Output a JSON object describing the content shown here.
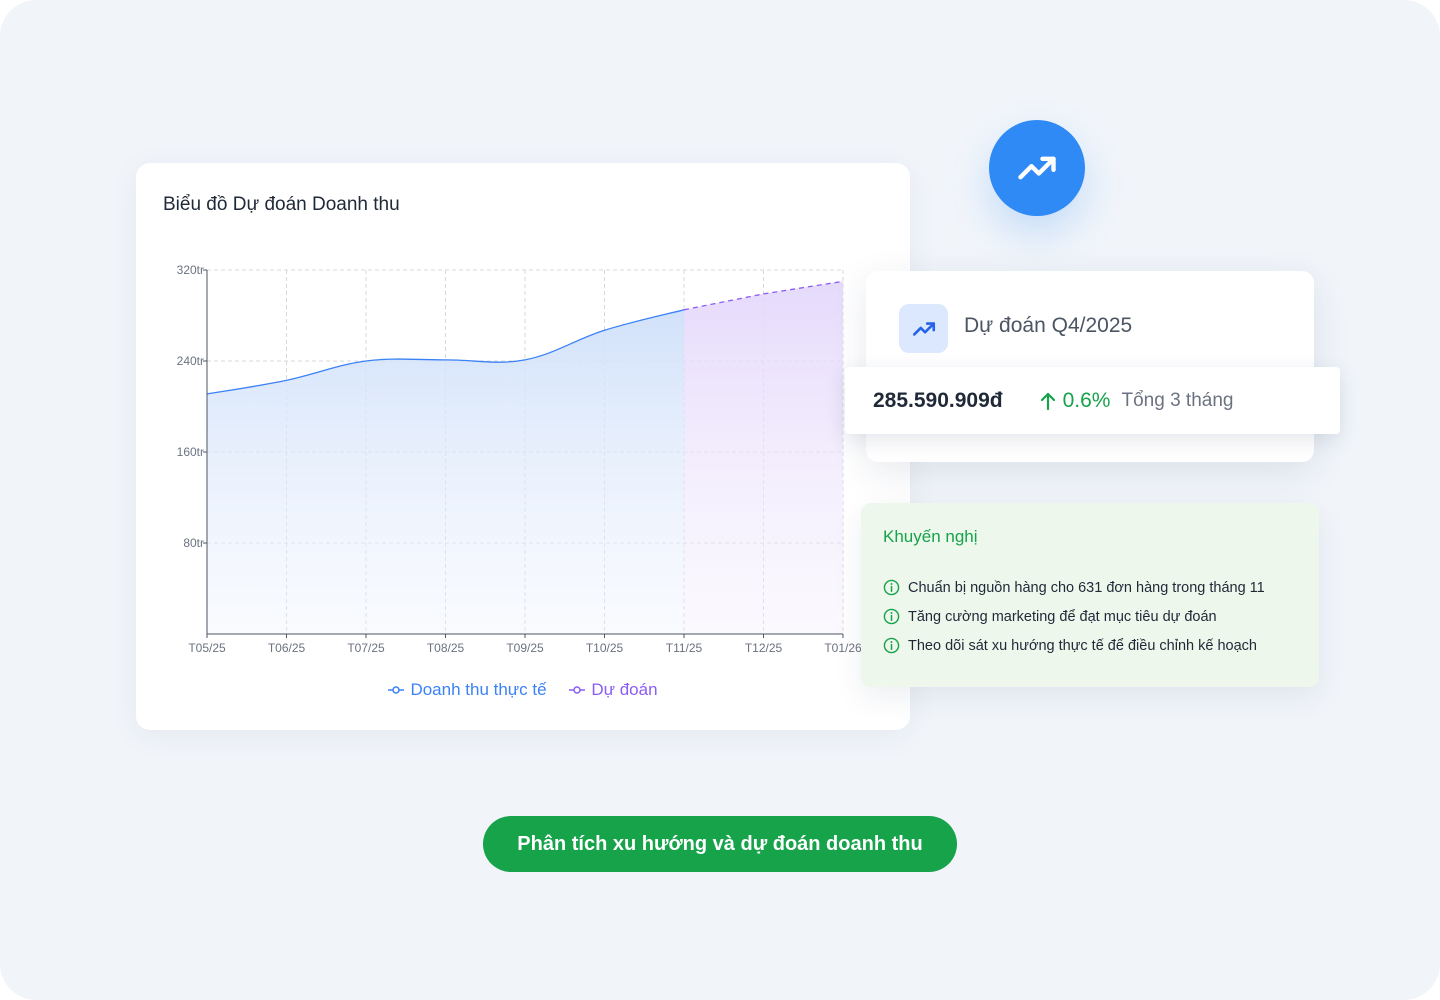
{
  "chart_card": {
    "title": "Biểu đồ Dự đoán Doanh thu"
  },
  "chart_data": {
    "type": "area",
    "categories": [
      "T05/25",
      "T06/25",
      "T07/25",
      "T08/25",
      "T09/25",
      "T10/25",
      "T11/25",
      "T12/25",
      "T01/26"
    ],
    "y_ticks": [
      "80tr",
      "160tr",
      "240tr",
      "320tr"
    ],
    "ylim": [
      0,
      320
    ],
    "unit": "tr",
    "grid": true,
    "legend_position": "bottom-center",
    "series": [
      {
        "name": "Doanh thu thực tế",
        "color": "#3b82f6",
        "x": [
          0,
          1,
          2,
          3,
          4,
          5,
          6
        ],
        "values": [
          211,
          223,
          240,
          241,
          241,
          267,
          285
        ]
      },
      {
        "name": "Dự đoán",
        "color": "#8b5cf6",
        "x": [
          6,
          7,
          8
        ],
        "values": [
          285,
          299,
          310
        ]
      }
    ]
  },
  "forecast": {
    "title": "Dự đoán Q4/2025",
    "value": "285.590.909đ",
    "delta": "0.6%",
    "note": "Tổng 3 tháng"
  },
  "recommendations": {
    "title": "Khuyến nghị",
    "items": [
      "Chuẩn bị nguồn hàng cho 631 đơn hàng trong tháng 11",
      "Tăng cường marketing để đạt mục tiêu dự đoán",
      "Theo dõi sát xu hướng thực tế để điều chỉnh kế hoạch"
    ]
  },
  "cta": {
    "label": "Phân tích xu hướng và dự đoán doanh thu"
  },
  "icons": {
    "fab": "trending-up-icon",
    "forecast": "trending-up-icon",
    "delta": "arrow-up-icon",
    "recommendation": "info-circle-icon"
  },
  "colors": {
    "accent_blue": "#2f8af5",
    "success_green": "#16a34a",
    "actual_line": "#3b82f6",
    "forecast_line": "#8b5cf6"
  }
}
